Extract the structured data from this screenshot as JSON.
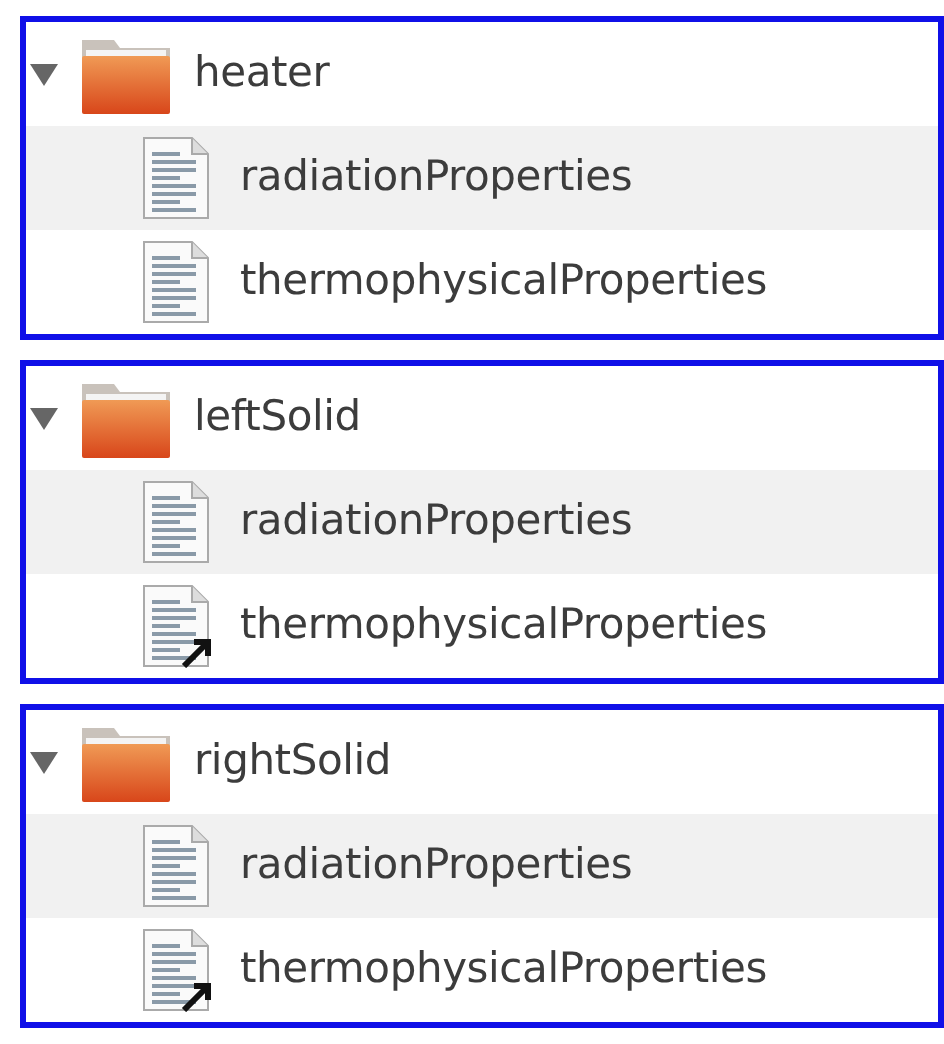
{
  "folders": [
    {
      "name": "heater",
      "expanded": true,
      "files": [
        {
          "name": "radiationProperties",
          "link": false
        },
        {
          "name": "thermophysicalProperties",
          "link": false
        }
      ]
    },
    {
      "name": "leftSolid",
      "expanded": true,
      "files": [
        {
          "name": "radiationProperties",
          "link": false
        },
        {
          "name": "thermophysicalProperties",
          "link": true
        }
      ]
    },
    {
      "name": "rightSolid",
      "expanded": true,
      "files": [
        {
          "name": "radiationProperties",
          "link": false
        },
        {
          "name": "thermophysicalProperties",
          "link": true
        }
      ]
    }
  ]
}
